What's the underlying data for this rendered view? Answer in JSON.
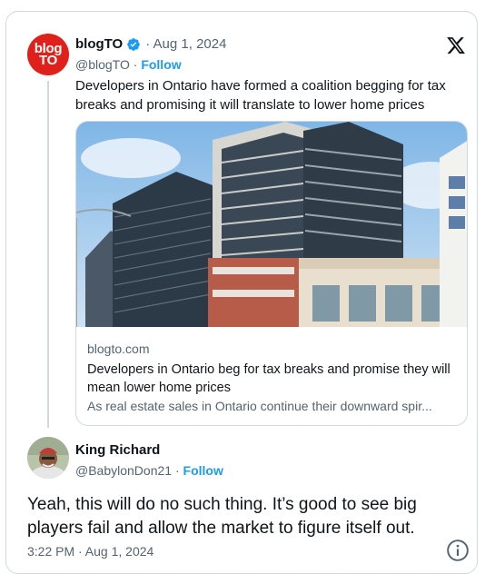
{
  "quoted_tweet": {
    "avatar_text_1": "blog",
    "avatar_text_2": "TO",
    "display_name": "blogTO",
    "date": "· Aug 1, 2024",
    "handle": "@blogTO ·",
    "follow_label": "Follow",
    "text": "Developers in Ontario have formed a coalition begging for tax breaks and promising it will translate to lower home prices",
    "link_card": {
      "domain": "blogto.com",
      "title": "Developers in Ontario beg for tax breaks and promise they will mean lower home prices",
      "description": "As real estate sales in Ontario continue their downward spir..."
    }
  },
  "reply": {
    "display_name": "King Richard",
    "handle": "@BabylonDon21 ·",
    "follow_label": "Follow",
    "text": "Yeah, this will do no such thing. It’s good to see big players fail and allow the market to figure itself out.",
    "timestamp": "3:22 PM · Aug 1, 2024"
  },
  "colors": {
    "brand_red": "#e0201b",
    "link_blue": "#1d9bf0",
    "muted_text": "#536471",
    "border": "#cfd9de"
  },
  "icons": [
    "verified-badge-icon",
    "x-logo-icon",
    "info-icon"
  ]
}
